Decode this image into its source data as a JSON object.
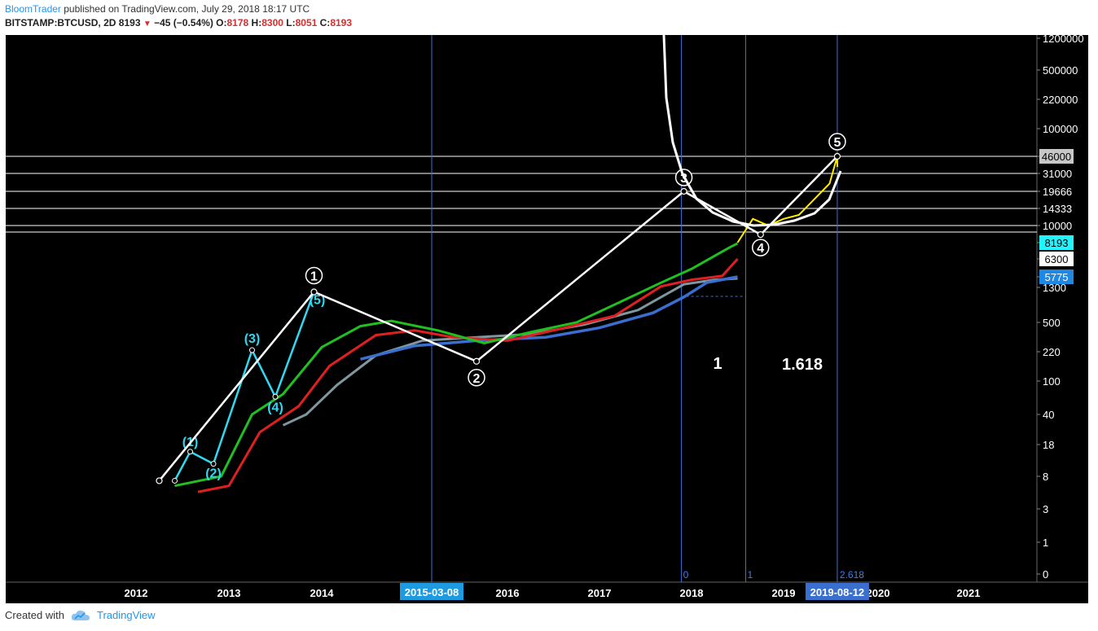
{
  "header": {
    "author": "BloomTrader",
    "published_text": " published on TradingView.com, July 29, 2018 18:17 UTC",
    "symbol": "BITSTAMP:BTCUSD, 2D",
    "last_price": "8193",
    "change": "−45 (−0.54%)",
    "o_label": "O:",
    "o_value": "8178",
    "h_label": "H:",
    "h_value": "8300",
    "l_label": "L:",
    "l_value": "8051",
    "c_label": "C:",
    "c_value": "8193"
  },
  "footer": {
    "created_with": "Created with",
    "brand": "TradingView"
  },
  "colors": {
    "background": "#000000",
    "accent": "#2196f3",
    "up_ribbon": "#22c41a",
    "down_ribbon": "#d01010",
    "cyan_wave": "#2fd9f2",
    "white_wave": "#ffffff",
    "ema_green": "#20c020",
    "ema_red": "#e02020",
    "ema_gray": "#7f98a0",
    "ema_blue": "#3a6fd0",
    "projection": "#ffee00"
  },
  "chart_data": {
    "type": "line",
    "scale": "log",
    "x_tick_labels": [
      "2012",
      "2013",
      "2014",
      "2016",
      "2017",
      "2018",
      "2019",
      "2020",
      "2021"
    ],
    "y_tick_labels": [
      "1200000",
      "500000",
      "220000",
      "100000",
      "46000",
      "31000",
      "19666",
      "14333",
      "10000",
      "8193",
      "6300",
      "5775",
      "1300",
      "500",
      "220",
      "100",
      "40",
      "18",
      "8",
      "3",
      "1",
      "0"
    ],
    "highlighted_price_labels": [
      {
        "label": "46000",
        "style": "gray"
      },
      {
        "label": "8193",
        "style": "cyan"
      },
      {
        "label": "6300",
        "style": "white"
      },
      {
        "label": "5775",
        "style": "blue"
      }
    ],
    "date_markers": [
      "2015-03-08",
      "2019-08-12"
    ],
    "fib_time_labels": [
      "0",
      "1",
      "2.618"
    ],
    "fib_ratio_labels": [
      "1",
      "1.618"
    ],
    "primary_wave_labels": [
      "1",
      "2",
      "3",
      "4",
      "5"
    ],
    "sub_wave_labels": [
      "(1)",
      "(2)",
      "(3)",
      "(4)",
      "(5)"
    ],
    "primary_waves": [
      {
        "label": "start",
        "date": "2012-04",
        "price": 7
      },
      {
        "label": "1",
        "date": "2013-12",
        "price": 1150
      },
      {
        "label": "2",
        "date": "2015-09",
        "price": 170
      },
      {
        "label": "3",
        "date": "2017-12",
        "price": 19666
      },
      {
        "label": "4",
        "date": "2018-10",
        "price": 9000
      },
      {
        "label": "5",
        "date": "2019-08",
        "price": 46000
      }
    ],
    "sub_waves": [
      {
        "label": "start",
        "date": "2012-06",
        "price": 7
      },
      {
        "label": "(1)",
        "date": "2012-08",
        "price": 15
      },
      {
        "label": "(2)",
        "date": "2012-11",
        "price": 11
      },
      {
        "label": "(3)",
        "date": "2013-04",
        "price": 230
      },
      {
        "label": "(4)",
        "date": "2013-07",
        "price": 65
      },
      {
        "label": "(5)",
        "date": "2013-12",
        "price": 1150
      }
    ],
    "horizontal_levels": [
      46000,
      31000,
      19666,
      14333,
      10000
    ]
  }
}
